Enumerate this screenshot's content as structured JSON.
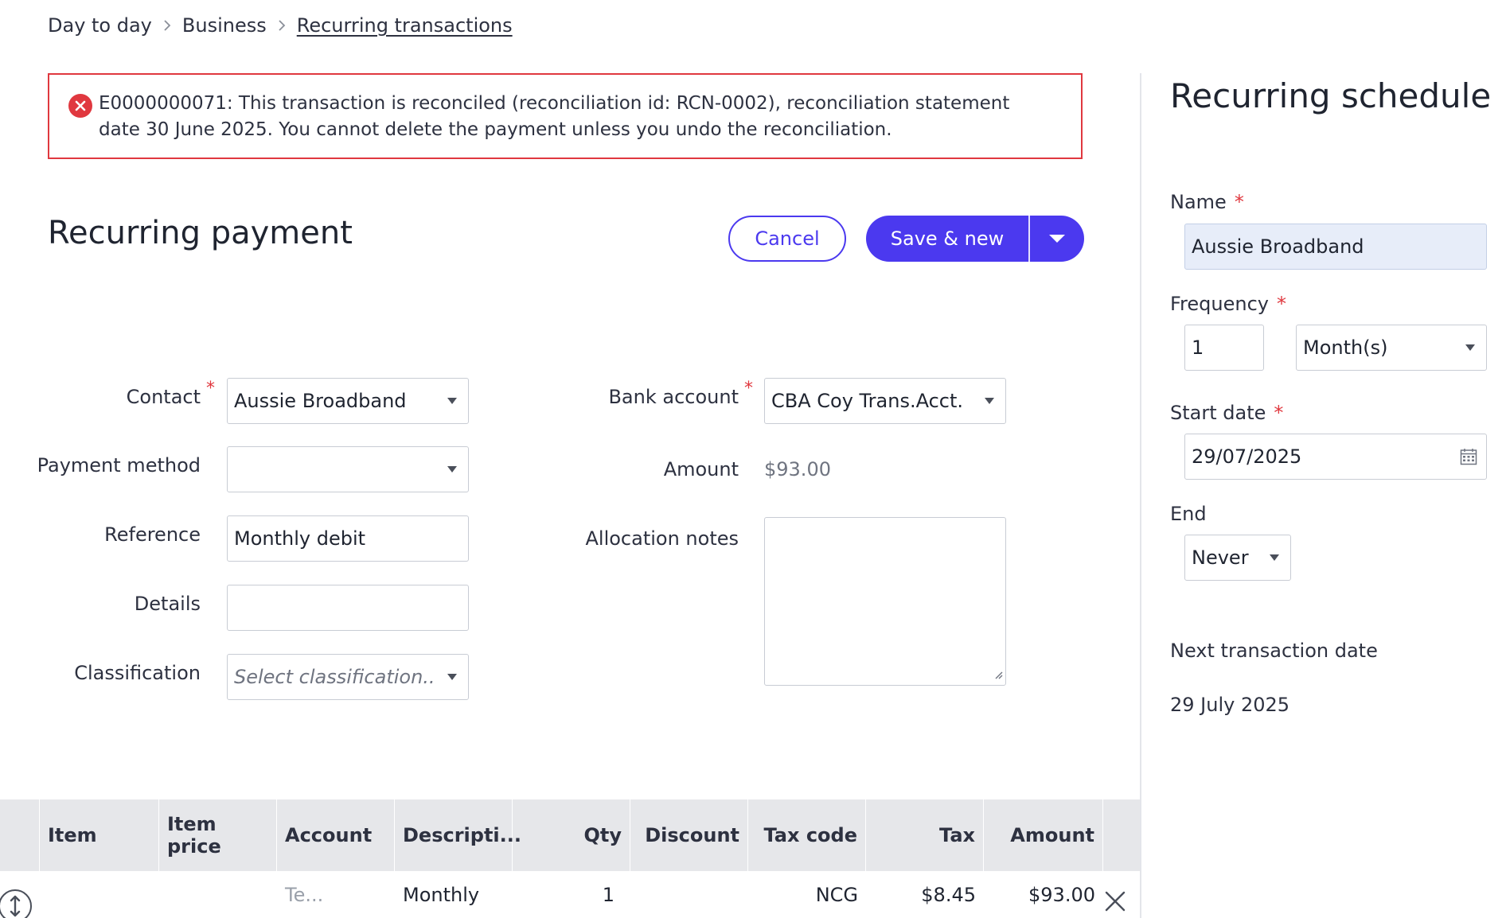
{
  "breadcrumb": {
    "items": [
      "Day to day",
      "Business",
      "Recurring transactions"
    ]
  },
  "error": {
    "message": "E0000000071: This transaction is reconciled (reconciliation id: RCN-0002), reconciliation statement date 30 June 2025. You cannot delete the payment unless you undo the reconciliation.",
    "color": "#e0383f"
  },
  "page": {
    "title": "Recurring payment"
  },
  "actions": {
    "cancel_label": "Cancel",
    "save_label": "Save & new",
    "primary_color": "#4b39ef"
  },
  "form": {
    "contact": {
      "label": "Contact",
      "value": "Aussie Broadband",
      "required": true
    },
    "payment_method": {
      "label": "Payment method",
      "value": ""
    },
    "reference": {
      "label": "Reference",
      "value": "Monthly debit"
    },
    "details": {
      "label": "Details",
      "value": ""
    },
    "classification": {
      "label": "Classification",
      "placeholder": "Select classification..."
    },
    "bank_account": {
      "label": "Bank account",
      "value": "CBA Coy Trans.Acct.",
      "required": true
    },
    "amount": {
      "label": "Amount",
      "value": "$93.00"
    },
    "allocation_notes": {
      "label": "Allocation notes",
      "value": ""
    },
    "required_marker": "*"
  },
  "schedule": {
    "title": "Recurring schedule",
    "name": {
      "label": "Name",
      "value": "Aussie Broadband",
      "required": true
    },
    "frequency": {
      "label": "Frequency",
      "count": "1",
      "unit": "Month(s)",
      "required": true
    },
    "start_date": {
      "label": "Start date",
      "value": "29/07/2025",
      "required": true
    },
    "end": {
      "label": "End",
      "value": "Never"
    },
    "next_transaction": {
      "label": "Next transaction date",
      "value": "29 July 2025"
    }
  },
  "table": {
    "columns": [
      "Item",
      "Item price",
      "Account",
      "Descripti...",
      "Qty",
      "Discount",
      "Tax code",
      "Tax",
      "Amount"
    ],
    "rows": [
      {
        "item": "",
        "item_price": "",
        "account": "Te...",
        "description": "Monthly",
        "qty": "1",
        "discount": "",
        "tax_code": "NCG",
        "tax": "$8.45",
        "amount": "$93.00"
      }
    ]
  },
  "icons": {
    "breadcrumb_separator": "chevron-right-icon",
    "error": "error-circle-icon",
    "dropdown": "caret-down-icon",
    "calendar": "calendar-icon",
    "drag": "drag-handle-icon",
    "delete": "close-icon"
  }
}
